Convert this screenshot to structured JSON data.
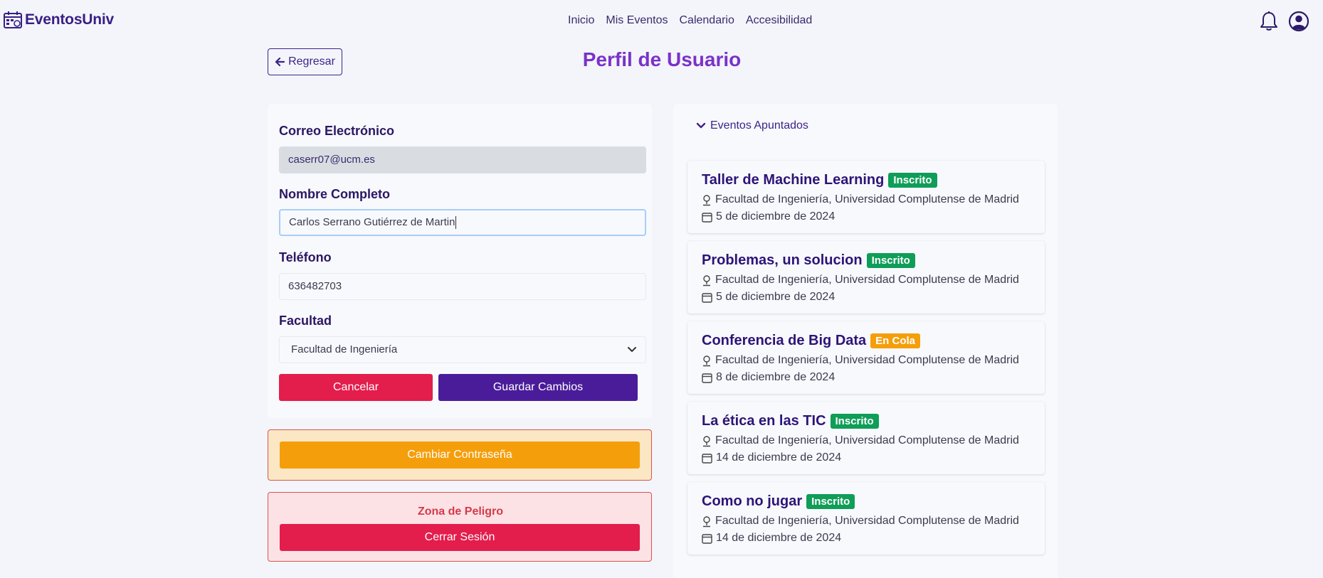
{
  "nav": {
    "brand": "EventosUniv",
    "links": [
      "Inicio",
      "Mis Eventos",
      "Calendario",
      "Accesibilidad"
    ]
  },
  "header": {
    "back_label": "Regresar",
    "title": "Perfil de Usuario"
  },
  "form": {
    "email_label": "Correo Electrónico",
    "email_value": "caserr07@ucm.es",
    "name_label": "Nombre Completo",
    "name_value": "Carlos Serrano Gutiérrez de Martin",
    "phone_label": "Teléfono",
    "phone_value": "636482703",
    "faculty_label": "Facultad",
    "faculty_value": "Facultad de Ingeniería",
    "cancel_label": "Cancelar",
    "save_label": "Guardar Cambios"
  },
  "password": {
    "button_label": "Cambiar Contraseña"
  },
  "danger": {
    "title": "Zona de Peligro",
    "logout_label": "Cerrar Sesión"
  },
  "events": {
    "toggle_label": "Eventos Apuntados",
    "items": [
      {
        "title": "Taller de Machine Learning",
        "status": "Inscrito",
        "location": "Facultad de Ingeniería, Universidad Complutense de Madrid",
        "date": "5 de diciembre de 2024"
      },
      {
        "title": "Problemas, un solucion",
        "status": "Inscrito",
        "location": "Facultad de Ingeniería, Universidad Complutense de Madrid",
        "date": "5 de diciembre de 2024"
      },
      {
        "title": "Conferencia de Big Data",
        "status": "En Cola",
        "location": "Facultad de Ingeniería, Universidad Complutense de Madrid",
        "date": "8 de diciembre de 2024"
      },
      {
        "title": "La ética en las TIC",
        "status": "Inscrito",
        "location": "Facultad de Ingeniería, Universidad Complutense de Madrid",
        "date": "14 de diciembre de 2024"
      },
      {
        "title": "Como no jugar",
        "status": "Inscrito",
        "location": "Facultad de Ingeniería, Universidad Complutense de Madrid",
        "date": "14 de diciembre de 2024"
      }
    ]
  },
  "colors": {
    "primary": "#4a1c9a",
    "title_accent": "#7a32c9",
    "danger": "#e31d4c",
    "warning": "#f59e0b",
    "success": "#0f9d58"
  }
}
